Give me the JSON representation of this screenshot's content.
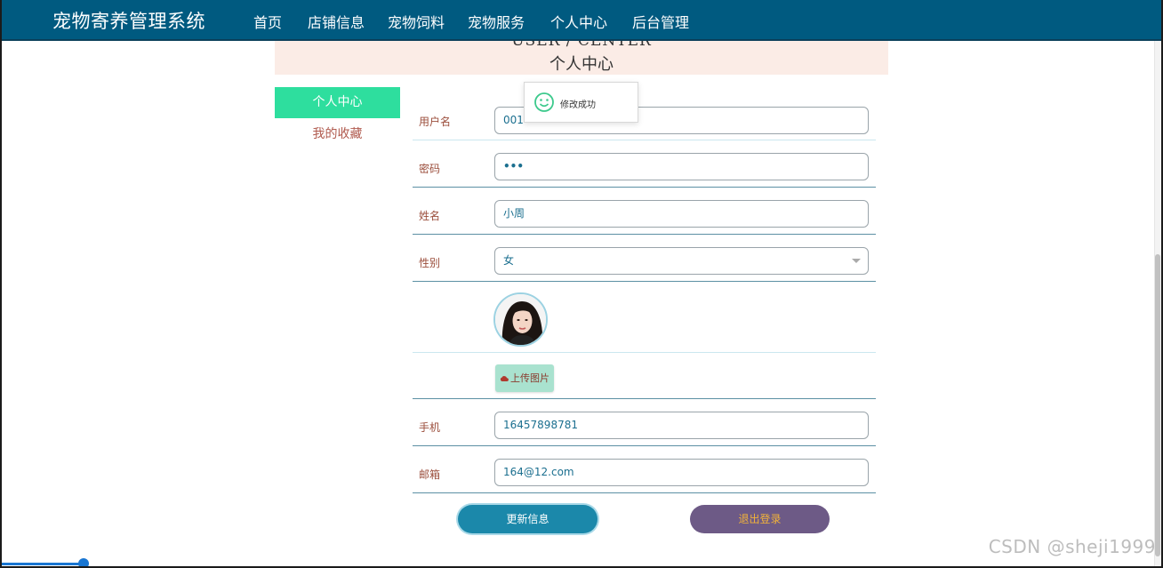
{
  "nav": {
    "brand": "宠物寄养管理系统",
    "items": [
      "首页",
      "店铺信息",
      "宠物饲料",
      "宠物服务",
      "个人中心",
      "后台管理"
    ]
  },
  "banner": {
    "en": "USER / CENTER",
    "cn": "个人中心"
  },
  "sidebar": {
    "active": "个人中心",
    "items": [
      "我的收藏"
    ]
  },
  "form": {
    "username": {
      "label": "用户名",
      "value": "001"
    },
    "password": {
      "label": "密码",
      "value": "•••"
    },
    "name": {
      "label": "姓名",
      "value": "小周"
    },
    "gender": {
      "label": "性别",
      "value": "女"
    },
    "upload_label": "上传图片",
    "phone": {
      "label": "手机",
      "value": "16457898781"
    },
    "email": {
      "label": "邮箱",
      "value": "164@12.com"
    }
  },
  "buttons": {
    "update": "更新信息",
    "logout": "退出登录"
  },
  "toast": {
    "text": "修改成功"
  },
  "watermark": "CSDN @sheji1999",
  "colors": {
    "navbar": "#005a80",
    "sidebar_active": "#2ede9e",
    "update_button": "#1b88aa",
    "logout_button": "#6d5a86",
    "banner_bg": "#fbece6"
  }
}
